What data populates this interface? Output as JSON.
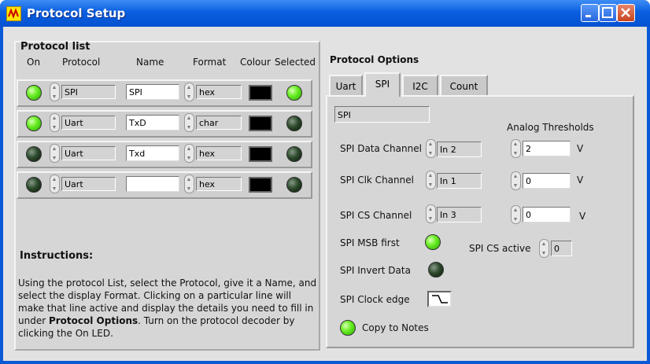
{
  "window": {
    "title": "Protocol Setup"
  },
  "protocol_list": {
    "title": "Protocol list",
    "headers": {
      "on": "On",
      "protocol": "Protocol",
      "name": "Name",
      "format": "Format",
      "colour": "Colour",
      "selected": "Selected"
    },
    "rows": [
      {
        "on": true,
        "protocol": "SPI",
        "name": "SPI",
        "format": "hex",
        "colour": "#000000",
        "selected": true
      },
      {
        "on": true,
        "protocol": "Uart",
        "name": "TxD",
        "format": "char",
        "colour": "#000000",
        "selected": false
      },
      {
        "on": false,
        "protocol": "Uart",
        "name": "Txd",
        "format": "hex",
        "colour": "#000000",
        "selected": false
      },
      {
        "on": false,
        "protocol": "Uart",
        "name": "",
        "format": "hex",
        "colour": "#000000",
        "selected": false
      }
    ]
  },
  "instructions": {
    "title": "Instructions:",
    "text_before": "Using the protocol List, select the Protocol, give it a Name, and select the display Format. Clicking on a particular line will make that line active and display the details you need to fill in under ",
    "text_bold": "Protocol Options",
    "text_after": ". Turn on the protocol decoder by clicking the On LED."
  },
  "protocol_options": {
    "title": "Protocol Options",
    "tabs": [
      "Uart",
      "SPI",
      "I2C",
      "Count"
    ],
    "active_tab": "SPI",
    "spi": {
      "header": "SPI",
      "analog_thresholds_label": "Analog Thresholds",
      "data_channel_label": "SPI Data Channel",
      "data_channel": "In 2",
      "data_threshold": "2",
      "clk_channel_label": "SPI Clk Channel",
      "clk_channel": "In 1",
      "clk_threshold": "0",
      "cs_channel_label": "SPI CS Channel",
      "cs_channel": "In 3",
      "cs_threshold": "0",
      "unit": "V",
      "msb_first_label": "SPI MSB first",
      "msb_first": true,
      "cs_active_label": "SPI CS active",
      "cs_active": "0",
      "invert_data_label": "SPI Invert Data",
      "invert_data": false,
      "clock_edge_label": "SPI Clock edge",
      "copy_to_notes_label": "Copy to Notes",
      "copy_to_notes": true
    }
  },
  "colors": {
    "titlebar": "#0a5ee0",
    "panel": "#d6d6d6",
    "led_on": "#6cef26",
    "led_off": "#2c4a2c"
  }
}
